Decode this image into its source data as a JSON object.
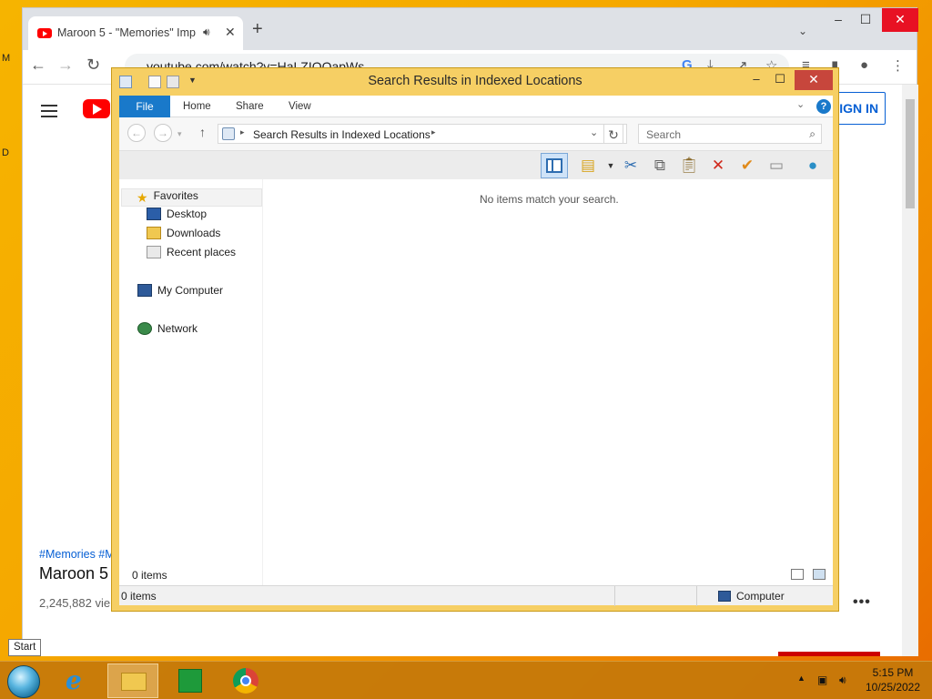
{
  "desktop": {
    "icon_letters": [
      "M",
      "D"
    ]
  },
  "chrome": {
    "tab": {
      "title": "Maroon 5 - \"Memories\" Imp",
      "audio_icon": "speaker-icon",
      "close_glyph": "✕"
    },
    "new_tab_glyph": "+",
    "caption": {
      "minimize": "–",
      "maximize": "☐",
      "close": "✕"
    },
    "tab_search_glyph": "⌄",
    "url": "youtube.com/watch?v=HaLZIOOapWs",
    "nav": {
      "back": "←",
      "forward": "→",
      "reload": "↻"
    },
    "toolbar_icons": [
      "google-lens-icon",
      "download-icon",
      "share-icon",
      "bookmark-star-icon",
      "reading-list-icon",
      "side-panel-icon",
      "profile-icon",
      "menu-icon"
    ]
  },
  "youtube": {
    "signin_label": "SIGN IN",
    "tags": "#Memories #M",
    "video_title": "Maroon 5",
    "views": "2,245,882 vie",
    "more_glyph": "•••",
    "brand_color": "#ff0000",
    "link_color": "#065fd4"
  },
  "explorer": {
    "title": "Search Results in Indexed Locations",
    "caption": {
      "minimize": "–",
      "maximize": "☐",
      "close": "✕"
    },
    "ribbon": {
      "file": "File",
      "tabs": [
        "Home",
        "Share",
        "View"
      ],
      "help": "?",
      "expand_glyph": "⌄"
    },
    "address": {
      "back": "←",
      "forward": "→",
      "up": "↑",
      "path": "Search Results in Indexed Locations",
      "refresh": "↻"
    },
    "search_placeholder": "Search",
    "search_glyph": "⌕",
    "nav_pane": {
      "favorites": "Favorites",
      "desktop": "Desktop",
      "downloads": "Downloads",
      "recent": "Recent places",
      "computer": "My Computer",
      "network": "Network"
    },
    "empty_message": "No items match your search.",
    "items_count": "0 items",
    "status": {
      "items": "0 items",
      "location": "Computer"
    },
    "accent_color": "#1979ca",
    "frame_color": "#f6cf64"
  },
  "tooltip": "Start",
  "taskbar": {
    "apps": [
      "internet-explorer-icon",
      "file-explorer-icon",
      "store-icon",
      "chrome-icon"
    ],
    "clock_time": "5:15 PM",
    "clock_date": "10/25/2022"
  }
}
